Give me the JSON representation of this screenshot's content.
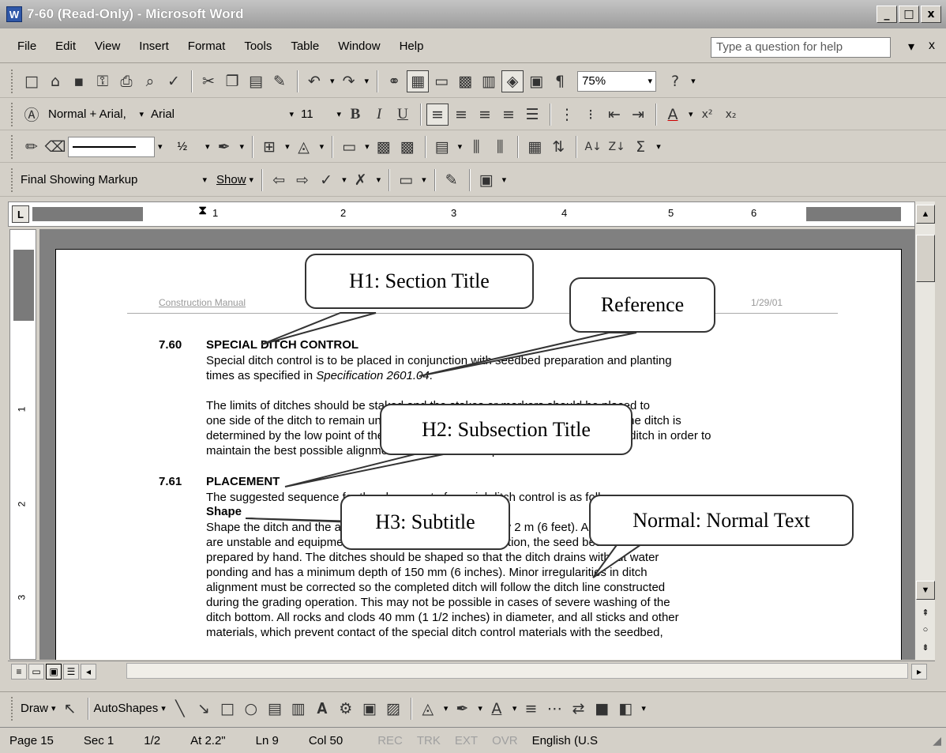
{
  "window": {
    "title": "7-60 (Read-Only) - Microsoft Word",
    "app_icon": "W",
    "controls": [
      "_",
      "□",
      "x"
    ]
  },
  "menubar": {
    "items": [
      "File",
      "Edit",
      "View",
      "Insert",
      "Format",
      "Tools",
      "Table",
      "Window",
      "Help"
    ],
    "help_placeholder": "Type a question for help",
    "right_glyphs": [
      "▾",
      "x"
    ]
  },
  "formatting": {
    "style": "Normal + Arial,",
    "font": "Arial",
    "size": "11",
    "zoom": "75%"
  },
  "reviewing": {
    "display": "Final Showing Markup",
    "show_label": "Show"
  },
  "drawing_toolbar": {
    "line_weight": "½",
    "draw_label": "Draw",
    "autoshapes_label": "AutoShapes"
  },
  "ruler": {
    "numbers": [
      "1",
      "2",
      "3",
      "4",
      "5",
      "6"
    ],
    "tab_marker": "L"
  },
  "vruler": {
    "numbers": [
      "1",
      "2",
      "3"
    ]
  },
  "document": {
    "header_left": "Construction Manual",
    "header_right": "1/29/01",
    "section_num": "7.60",
    "section_title": "SPECIAL DITCH CONTROL",
    "para1_line1": "Special ditch control is to be placed in conjunction with seedbed preparation and planting",
    "para1_line2_a": "times as specified in ",
    "para1_line2_spec": "Specification 2601.04",
    "para1_line2_b": ".",
    "para2_line1": "The limits of ditches should be staked and the stakes or markers should be placed to",
    "para2_line2": "one side of the ditch to remain until construction is completed. The centerline of the ditch is",
    "para2_line3": "determined by the low point of the existing ditch. It may be necessary to shift the ditch in order to",
    "para2_line4": "maintain the best possible alignment and to avoid sharp turns in sod ditches.",
    "subsection_num": "7.61",
    "subsection_title": "PLACEMENT",
    "para3_line1": "The suggested sequence for the placement of special ditch control is as follows.",
    "subtitle": "Shape",
    "para4_line1": "Shape the ditch and the adjacent slopes for approximately 2 m (6 feet). Areas that",
    "para4_line2": "are unstable and equipment leaves them in a rough condition, the seed bed must be",
    "para4_line3": "prepared by hand.  The ditches should be shaped so that the ditch drains without water",
    "para4_line4": "ponding and has a minimum depth of 150 mm (6 inches).  Minor irregularities in ditch",
    "para4_line5": "alignment must be corrected so the completed ditch will follow the ditch line constructed",
    "para4_line6": "during the grading operation.  This may not be possible in cases of severe washing of the",
    "para4_line7": "ditch bottom.  All rocks and clods 40 mm (1 1/2 inches) in diameter, and all sticks and other",
    "para4_line8": "materials, which prevent contact of the special ditch control materials with the seedbed,"
  },
  "callouts": {
    "h1": "H1: Section Title",
    "reference": "Reference",
    "h2": "H2: Subsection Title",
    "h3": "H3: Subtitle",
    "normal": "Normal: Normal Text"
  },
  "status": {
    "page": "Page 15",
    "sec": "Sec 1",
    "pages": "1/2",
    "at": "At 2.2\"",
    "ln": "Ln 9",
    "col": "Col 50",
    "rec": "REC",
    "trk": "TRK",
    "ext": "EXT",
    "ovr": "OVR",
    "lang": "English (U.S"
  }
}
